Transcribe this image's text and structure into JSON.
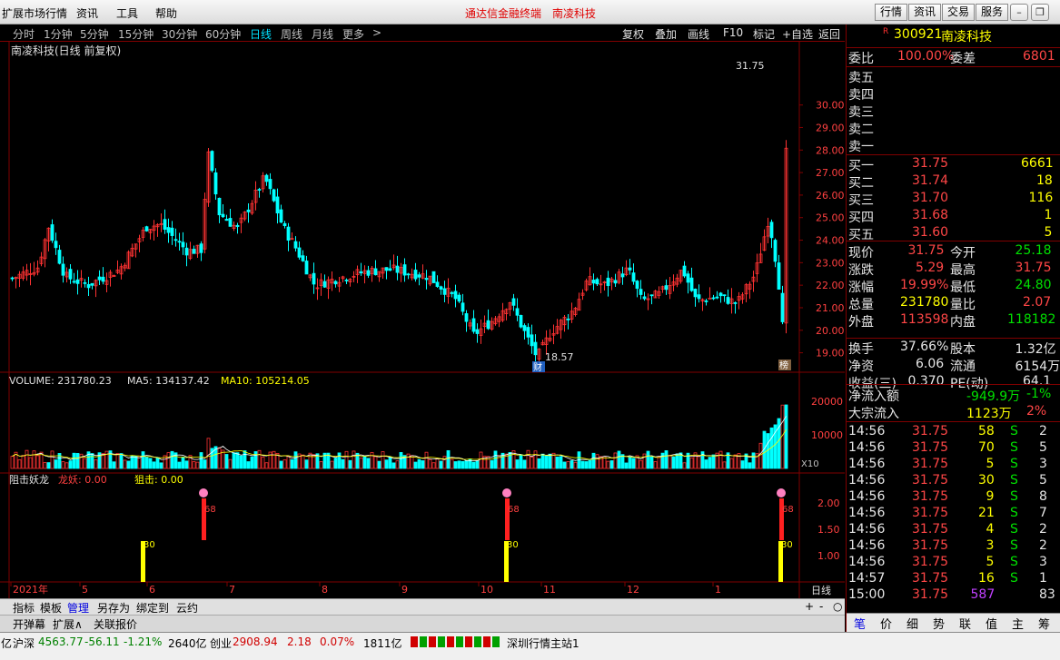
{
  "menubar": {
    "items": [
      "扩展市场行情",
      "资讯",
      "工具",
      "帮助"
    ],
    "center_title": "通达信金融终端",
    "center_stock": "南凌科技",
    "right_buttons": [
      "行情",
      "资讯",
      "交易",
      "服务"
    ]
  },
  "periods": {
    "items": [
      "分时",
      "1分钟",
      "5分钟",
      "15分钟",
      "30分钟",
      "60分钟",
      "日线",
      "周线",
      "月线",
      "更多"
    ],
    "active": "日线",
    "more_arrow": ">"
  },
  "toolbar": {
    "items": [
      "复权",
      "叠加",
      "画线",
      "F10",
      "标记",
      "+自选",
      "返回"
    ]
  },
  "chart": {
    "title": "南凌科技(日线 前复权)",
    "high_label": "31.75",
    "low_label": "18.57",
    "badge_cai": "财",
    "badge_bang": "榜",
    "price_axis": [
      "30.00",
      "29.00",
      "28.00",
      "27.00",
      "26.00",
      "25.00",
      "24.00",
      "23.00",
      "22.00",
      "21.00",
      "20.00",
      "19.00"
    ],
    "volume_header": {
      "volume": "VOLUME: 231780.23",
      "ma5": "MA5: 134137.42",
      "ma10": "MA10: 105214.05"
    },
    "volume_axis": [
      "20000",
      "10000"
    ],
    "volume_unit": "X10",
    "ind_header": {
      "name": "阻击妖龙",
      "dragon": "龙妖: 0.00",
      "snipe": "狙击: 0.00"
    },
    "ind_axis": [
      "2.00",
      "1.50",
      "1.00"
    ],
    "ind_labels": {
      "red": "68",
      "yellow": "30"
    },
    "date_axis": [
      "2021年",
      "5",
      "6",
      "7",
      "8",
      "9",
      "10",
      "11",
      "12",
      "1"
    ],
    "axis_period": "日线",
    "zoom": [
      "+",
      "-",
      "○"
    ],
    "colors": {
      "up": "#ff3232",
      "down": "#00ffff",
      "ma5": "#ffffff",
      "ma10": "#ffff00"
    }
  },
  "chart_data": {
    "type": "candlestick",
    "high": 31.75,
    "low": 18.57,
    "ylim": [
      18.5,
      31.8
    ],
    "volume": {
      "last": 231780.23,
      "ma5": 134137.42,
      "ma10": 105214.05
    }
  },
  "bottom_tabs": [
    "指标",
    "模板",
    "管理",
    "另存为",
    "绑定到",
    "云约"
  ],
  "bottom_tabs_active": "管理",
  "bottom_tabs2": [
    "开弹幕",
    "扩展∧",
    "关联报价"
  ],
  "quote": {
    "code": "300921",
    "name": "南凌科技",
    "flag": "R",
    "weibi": {
      "label": "委比",
      "value": "100.00%",
      "label2": "委差",
      "value2": "6801"
    },
    "sell": [
      {
        "label": "卖五"
      },
      {
        "label": "卖四"
      },
      {
        "label": "卖三"
      },
      {
        "label": "卖二"
      },
      {
        "label": "卖一"
      }
    ],
    "buy": [
      {
        "label": "买一",
        "price": "31.75",
        "vol": "6661"
      },
      {
        "label": "买二",
        "price": "31.74",
        "vol": "18"
      },
      {
        "label": "买三",
        "price": "31.70",
        "vol": "116"
      },
      {
        "label": "买四",
        "price": "31.68",
        "vol": "1"
      },
      {
        "label": "买五",
        "price": "31.60",
        "vol": "5"
      }
    ],
    "stats": [
      {
        "l1": "现价",
        "v1": "31.75",
        "l2": "今开",
        "v2": "25.18"
      },
      {
        "l1": "涨跌",
        "v1": "5.29",
        "l2": "最高",
        "v2": "31.75"
      },
      {
        "l1": "涨幅",
        "v1": "19.99%",
        "l2": "最低",
        "v2": "24.80"
      },
      {
        "l1": "总量",
        "v1": "231780",
        "l2": "量比",
        "v2": "2.07"
      },
      {
        "l1": "外盘",
        "v1": "113598",
        "l2": "内盘",
        "v2": "118182"
      }
    ],
    "stats2": [
      {
        "l1": "换手",
        "v1": "37.66%",
        "l2": "股本",
        "v2": "1.32亿"
      },
      {
        "l1": "净资",
        "v1": "6.06",
        "l2": "流通",
        "v2": "6154万"
      },
      {
        "l1": "收益(三)",
        "v1": "0.370",
        "l2": "PE(动)",
        "v2": "64.1"
      }
    ],
    "flow": [
      {
        "label": "净流入额",
        "value": "-949.9万",
        "pct": "-1%"
      },
      {
        "label": "大宗流入",
        "value": "1123万",
        "pct": "2%"
      }
    ],
    "ticks": [
      {
        "t": "14:56",
        "p": "31.75",
        "v": "58",
        "s": "S",
        "n": "2"
      },
      {
        "t": "14:56",
        "p": "31.75",
        "v": "70",
        "s": "S",
        "n": "5"
      },
      {
        "t": "14:56",
        "p": "31.75",
        "v": "5",
        "s": "S",
        "n": "3"
      },
      {
        "t": "14:56",
        "p": "31.75",
        "v": "30",
        "s": "S",
        "n": "5"
      },
      {
        "t": "14:56",
        "p": "31.75",
        "v": "9",
        "s": "S",
        "n": "8"
      },
      {
        "t": "14:56",
        "p": "31.75",
        "v": "21",
        "s": "S",
        "n": "7"
      },
      {
        "t": "14:56",
        "p": "31.75",
        "v": "4",
        "s": "S",
        "n": "2"
      },
      {
        "t": "14:56",
        "p": "31.75",
        "v": "3",
        "s": "S",
        "n": "2"
      },
      {
        "t": "14:56",
        "p": "31.75",
        "v": "5",
        "s": "S",
        "n": "3"
      },
      {
        "t": "14:57",
        "p": "31.75",
        "v": "16",
        "s": "S",
        "n": "1"
      },
      {
        "t": "15:00",
        "p": "31.75",
        "v": "587",
        "s": "",
        "n": "83"
      }
    ],
    "bottom_tabs": [
      "笔",
      "价",
      "细",
      "势",
      "联",
      "值",
      "主",
      "筹"
    ]
  },
  "status": {
    "prefix": "亿",
    "sz_label": "沪深",
    "sz_val": "4563.77",
    "sz_chg": "-56.11",
    "sz_pct": "-1.21%",
    "sz_amt": "2640亿",
    "cy_label": "创业",
    "cy_val": "2908.94",
    "cy_chg": "2.18",
    "cy_pct": "0.07%",
    "cy_amt": "1811亿",
    "server": "深圳行情主站1"
  }
}
